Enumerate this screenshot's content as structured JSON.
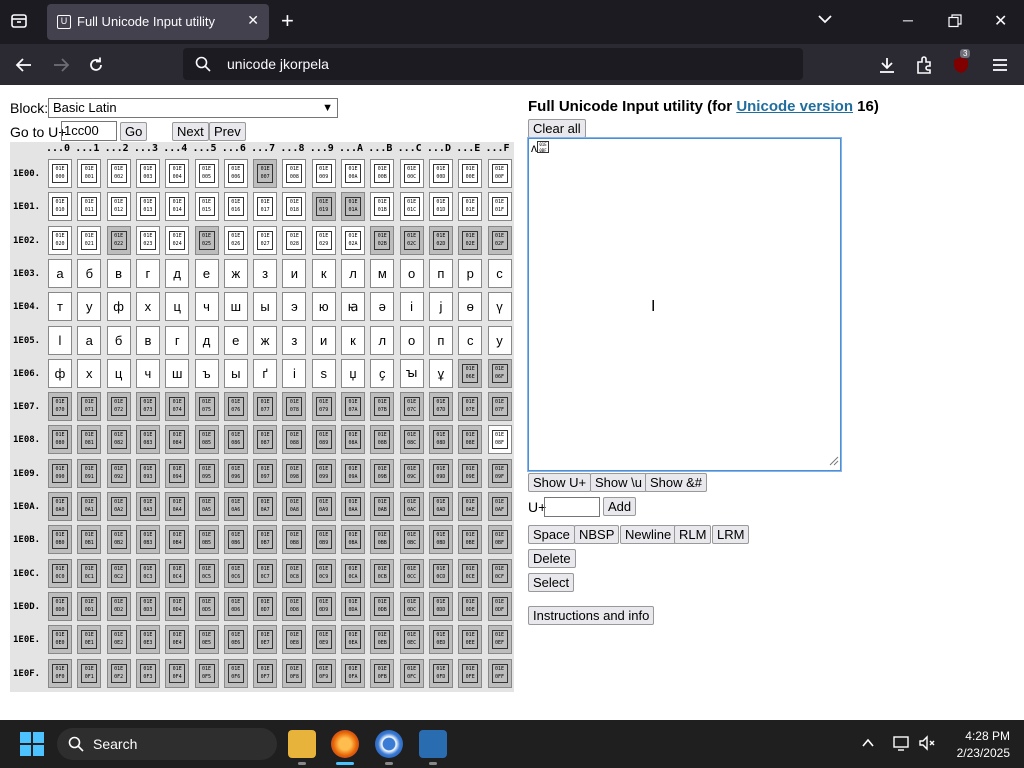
{
  "browser": {
    "tab_title": "Full Unicode Input utility",
    "url_text": "unicode jkorpela",
    "extension_badge": "3"
  },
  "page": {
    "block_label": "Block:",
    "block_selected": "Basic Latin",
    "goto_label": "Go to U+",
    "goto_value": "1cc00",
    "go_button": "Go",
    "next_button": "Next",
    "prev_button": "Prev",
    "col_headers": [
      "...0",
      "...1",
      "...2",
      "...3",
      "...4",
      "...5",
      "...6",
      "...7",
      "...8",
      "...9",
      "...A",
      "...B",
      "...C",
      "...D",
      "...E",
      "...F"
    ],
    "row_headers": [
      "1E00.",
      "1E01.",
      "1E02.",
      "1E03.",
      "1E04.",
      "1E05.",
      "1E06.",
      "1E07.",
      "1E08.",
      "1E09.",
      "1E0A.",
      "1E0B.",
      "1E0C.",
      "1E0D.",
      "1E0E.",
      "1E0F."
    ],
    "glyph_rows": {
      "1E03": [
        "а",
        "б",
        "в",
        "г",
        "д",
        "е",
        "ж",
        "з",
        "и",
        "к",
        "л",
        "м",
        "о",
        "п",
        "р",
        "с"
      ],
      "1E04": [
        "т",
        "у",
        "ф",
        "х",
        "ц",
        "ч",
        "ш",
        "ы",
        "э",
        "ю",
        "ꙗ",
        "ә",
        "і",
        "ј",
        "ө",
        "ү"
      ],
      "1E05": [
        "ӏ",
        "а",
        "б",
        "в",
        "г",
        "д",
        "е",
        "ж",
        "з",
        "и",
        "к",
        "л",
        "о",
        "п",
        "с",
        "у"
      ],
      "1E06": [
        "ф",
        "х",
        "ц",
        "ч",
        "ш",
        "ъ",
        "ы",
        "ґ",
        "і",
        "ѕ",
        "џ",
        "ҫ",
        "ꙑ",
        "ұ",
        "",
        ""
      ]
    },
    "util_title_prefix": "Full Unicode Input utility (for ",
    "util_title_link": "Unicode version",
    "util_title_suffix": " 16)",
    "clear_all": "Clear all",
    "textarea_content": "ʌ",
    "show_u": "Show U+",
    "show_backslash_u": "Show \\u",
    "show_amp": "Show &#",
    "uplus_label": "U+",
    "add_button": "Add",
    "space_button": "Space",
    "nbsp_button": "NBSP",
    "newline_button": "Newline",
    "rlm_button": "RLM",
    "lrm_button": "LRM",
    "delete_button": "Delete",
    "select_button": "Select",
    "instructions_button": "Instructions and info"
  },
  "taskbar": {
    "search_label": "Search",
    "time": "4:28 PM",
    "date": "2/23/2025"
  }
}
